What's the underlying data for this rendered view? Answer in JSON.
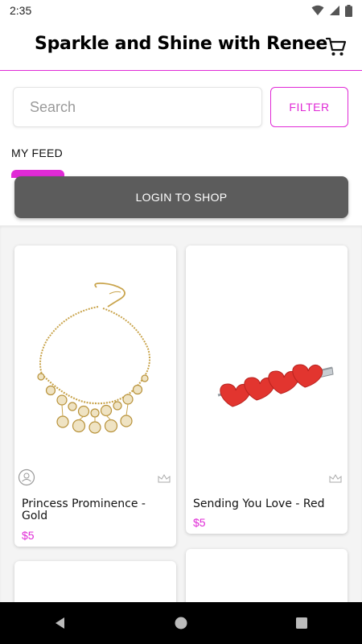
{
  "status_bar": {
    "time": "2:35"
  },
  "header": {
    "title": "Sparkle and Shine with Renee"
  },
  "search": {
    "placeholder": "Search"
  },
  "filter": {
    "label": "FILTER"
  },
  "tabs": [
    {
      "label": "MY FEED",
      "active": true
    }
  ],
  "login": {
    "label": "LOGIN TO SHOP"
  },
  "products": [
    {
      "name": "Princess Prominence - Gold",
      "price": "$5"
    },
    {
      "name": "Sending You Love - Red",
      "price": "$5"
    }
  ],
  "colors": {
    "accent": "#e02ad6",
    "login_bg": "#5c5c5c",
    "feed_bg": "#f4f4f4"
  },
  "icons": [
    "wifi-icon",
    "signal-icon",
    "battery-icon",
    "cart-icon",
    "seller-avatar-icon",
    "crown-icon",
    "back-icon",
    "home-icon",
    "recents-icon"
  ]
}
